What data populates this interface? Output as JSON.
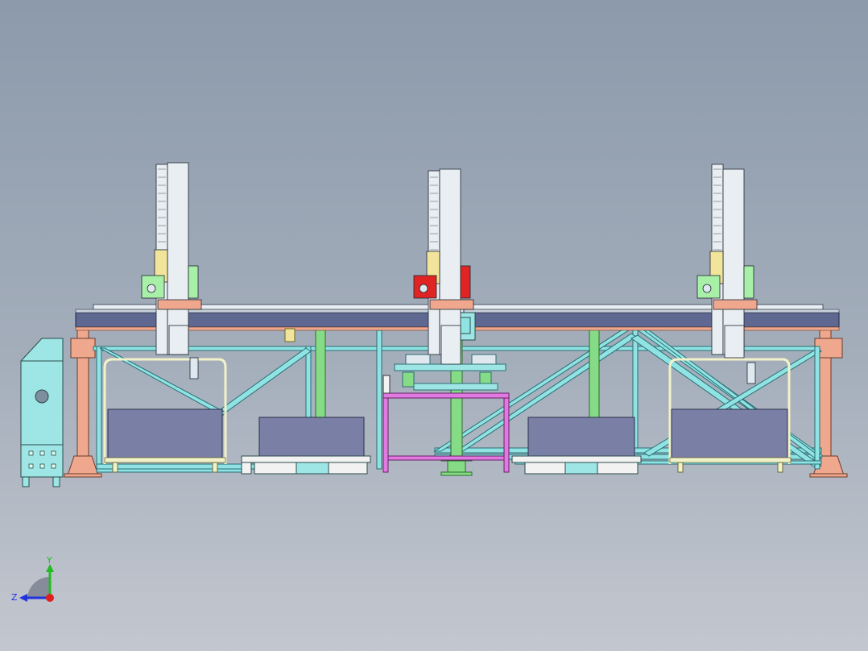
{
  "colors": {
    "background_top": "#8c9aab",
    "background_bottom": "#c3c7cf",
    "frame_cyan": "#8fe3e3",
    "beam_blue": "#5f6890",
    "support_salmon": "#efa88e",
    "column_green": "#86dc86",
    "pallet_box": "#7a7fa6",
    "table_magenta": "#e07ae0",
    "cabinet_cyan": "#9ee6e6",
    "carriage_red": "#e02424",
    "carriage_green": "#a8f0a8",
    "carriage_yellow": "#f2e49a"
  },
  "axis_triad": {
    "y_label": "Y",
    "z_label": "Z",
    "y_color": "#22bb22",
    "z_color": "#2233dd",
    "x_color": "#e02020"
  },
  "icons": {
    "triad": "axis-triad-icon",
    "hmi": "hmi-screen-icon",
    "cabinet_knob": "cabinet-knob-icon"
  }
}
